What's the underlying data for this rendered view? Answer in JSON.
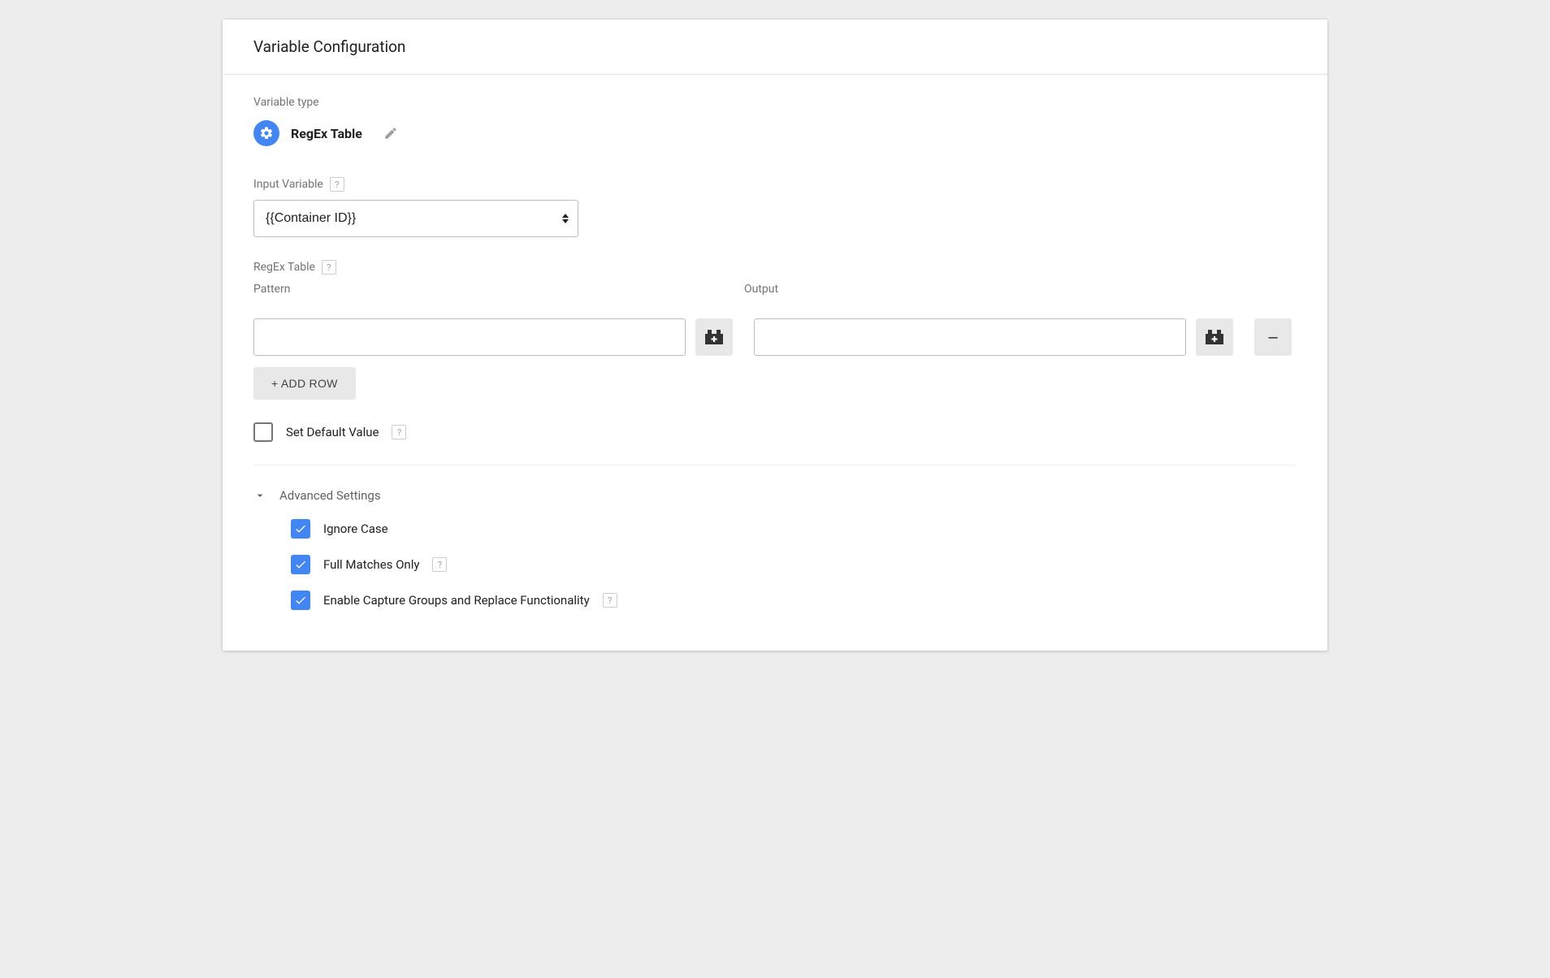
{
  "header": {
    "title": "Variable Configuration"
  },
  "variable_type": {
    "label": "Variable type",
    "name": "RegEx Table"
  },
  "input_variable": {
    "label": "Input Variable",
    "value": "{{Container ID}}"
  },
  "regex_table": {
    "label": "RegEx Table",
    "columns": {
      "pattern": "Pattern",
      "output": "Output"
    },
    "rows": [
      {
        "pattern": "",
        "output": ""
      }
    ],
    "add_row_label": "+ ADD ROW",
    "remove_row_label": "–"
  },
  "default_value": {
    "label": "Set Default Value",
    "checked": false
  },
  "advanced": {
    "title": "Advanced Settings",
    "options": [
      {
        "label": "Ignore Case",
        "checked": true,
        "help": false
      },
      {
        "label": "Full Matches Only",
        "checked": true,
        "help": true
      },
      {
        "label": "Enable Capture Groups and Replace Functionality",
        "checked": true,
        "help": true
      }
    ]
  },
  "help_glyph": "?"
}
